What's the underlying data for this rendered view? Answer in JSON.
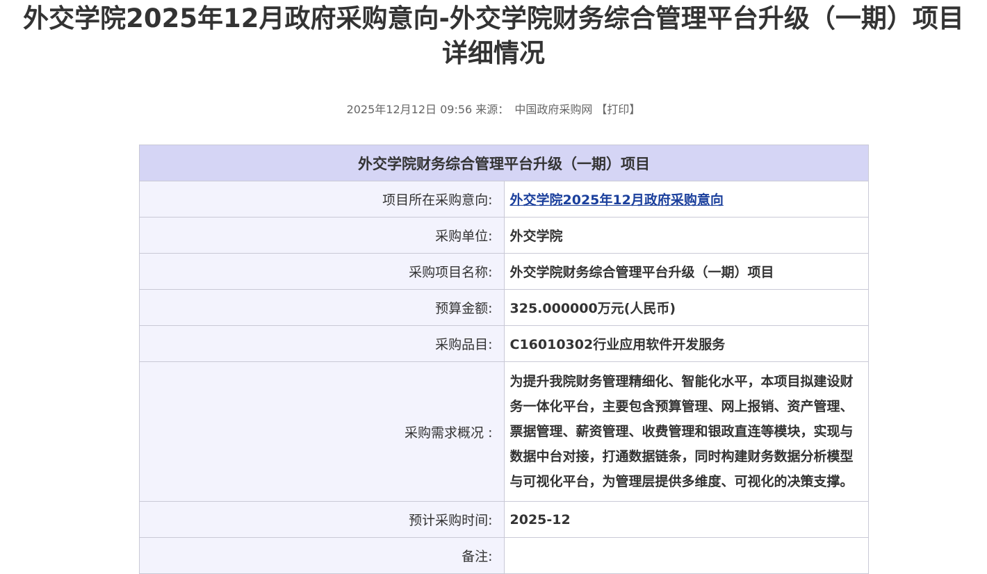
{
  "page": {
    "title_line1": "外交学院2025年12月政府采购意向-外交学院财务综合管理平台升级（一期）项目",
    "title_line2": "详细情况"
  },
  "meta": {
    "datetime": "2025年12月12日 09:56",
    "source_label": "来源：",
    "source_value": "中国政府采购网",
    "print_label": "【打印】"
  },
  "table": {
    "header": "外交学院财务综合管理平台升级（一期）项目",
    "rows": [
      {
        "label": "项目所在采购意向:",
        "value": "外交学院2025年12月政府采购意向"
      },
      {
        "label": "采购单位:",
        "value": "外交学院"
      },
      {
        "label": "采购项目名称:",
        "value": "外交学院财务综合管理平台升级（一期）项目"
      },
      {
        "label": "预算金额:",
        "value": "325.000000万元(人民币)"
      },
      {
        "label": "采购品目:",
        "value": "C16010302行业应用软件开发服务"
      },
      {
        "label": "采购需求概况 :",
        "value": "为提升我院财务管理精细化、智能化水平，本项目拟建设财务一体化平台，主要包含预算管理、网上报销、资产管理、票据管理、薪资管理、收费管理和银政直连等模块，实现与数据中台对接，打通数据链条，同时构建财务数据分析模型与可视化平台，为管理层提供多维度、可视化的决策支撑。"
      },
      {
        "label": "预计采购时间:",
        "value": "2025-12"
      },
      {
        "label": "备注:",
        "value": ""
      }
    ]
  },
  "colors": {
    "header_bg": "#d5d5f5",
    "label_bg": "#f3f3fd",
    "link": "#1a3f9c",
    "border": "#c9c9d6"
  }
}
